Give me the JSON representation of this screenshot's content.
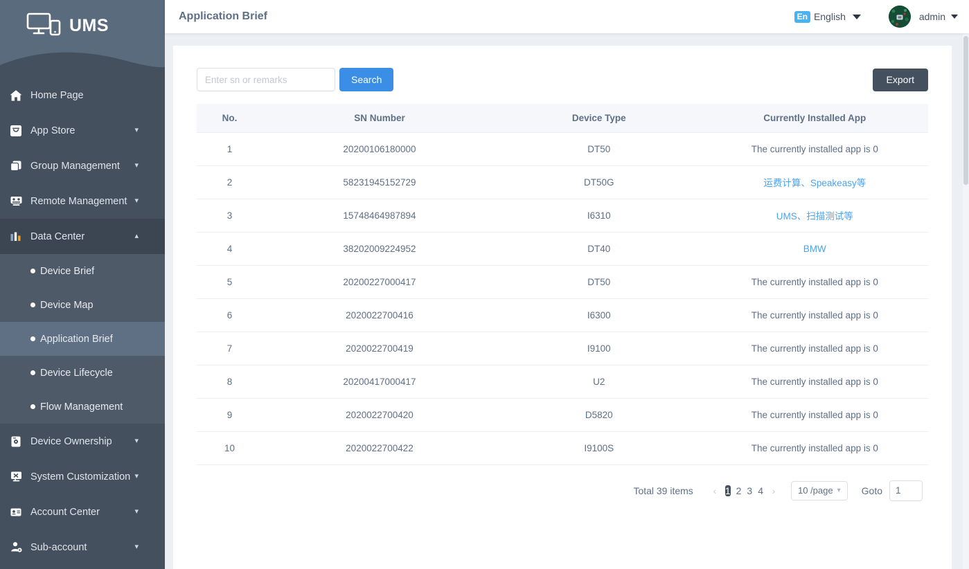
{
  "brand": {
    "logo_text": "UMS",
    "logo_icon": "devices-icon"
  },
  "header": {
    "title": "Application Brief",
    "language": {
      "badge": "En",
      "label": "English",
      "icon": "chevron-down-icon"
    },
    "user": {
      "name": "admin",
      "avatar_icon": "user-avatar"
    }
  },
  "colors": {
    "sidebar_bg": "#44505e",
    "sidebar_logo_bg": "#5a6b7d",
    "sidebar_sub_bg": "#4e5a68",
    "sidebar_active": "#5f7085",
    "primary_blue": "#3a8ee6",
    "link_blue": "#4aa3f0",
    "dark_button": "#44505e",
    "lang_badge": "#4ab3ee",
    "page_bg": "#eceff3"
  },
  "sidebar": {
    "items": [
      {
        "label": "Home Page",
        "icon": "home-icon",
        "caret": "",
        "expandable": false
      },
      {
        "label": "App Store",
        "icon": "appstore-icon",
        "caret": "⌄",
        "expandable": true
      },
      {
        "label": "Group Management",
        "icon": "group-icon",
        "caret": "⌄",
        "expandable": true
      },
      {
        "label": "Remote Management",
        "icon": "remote-icon",
        "caret": "⌄",
        "expandable": true
      },
      {
        "label": "Data Center",
        "icon": "chart-icon",
        "caret": "⌃",
        "expandable": true,
        "open": true
      },
      {
        "label": "Device Ownership",
        "icon": "ownership-icon",
        "caret": "⌄",
        "expandable": true
      },
      {
        "label": "System Customization",
        "icon": "system-icon",
        "caret": "⌄",
        "expandable": true
      },
      {
        "label": "Account Center",
        "icon": "account-icon",
        "caret": "⌄",
        "expandable": true
      },
      {
        "label": "Sub-account",
        "icon": "subaccount-icon",
        "caret": "⌄",
        "expandable": true
      }
    ],
    "data_center_subitems": [
      {
        "label": "Device Brief",
        "active": false
      },
      {
        "label": "Device Map",
        "active": false
      },
      {
        "label": "Application Brief",
        "active": true
      },
      {
        "label": "Device Lifecycle",
        "active": false
      },
      {
        "label": "Flow Management",
        "active": false
      }
    ]
  },
  "toolbar": {
    "search_placeholder": "Enter sn or remarks",
    "search_value": "",
    "search_label": "Search",
    "export_label": "Export"
  },
  "table": {
    "columns": [
      "No.",
      "SN Number",
      "Device Type",
      "Currently Installed App"
    ],
    "rows": [
      {
        "no": "1",
        "sn": "20200106180000",
        "device_type": "DT50",
        "app": "The currently installed app is 0",
        "app_is_link": false
      },
      {
        "no": "2",
        "sn": "58231945152729",
        "device_type": "DT50G",
        "app": "运费计算、Speakeasy等",
        "app_is_link": true
      },
      {
        "no": "3",
        "sn": "15748464987894",
        "device_type": "I6310",
        "app": "UMS、扫描测试等",
        "app_is_link": true
      },
      {
        "no": "4",
        "sn": "38202009224952",
        "device_type": "DT40",
        "app": "BMW",
        "app_is_link": true
      },
      {
        "no": "5",
        "sn": "20200227000417",
        "device_type": "DT50",
        "app": "The currently installed app is 0",
        "app_is_link": false
      },
      {
        "no": "6",
        "sn": "2020022700416",
        "device_type": "I6300",
        "app": "The currently installed app is 0",
        "app_is_link": false
      },
      {
        "no": "7",
        "sn": "2020022700419",
        "device_type": "I9100",
        "app": "The currently installed app is 0",
        "app_is_link": false
      },
      {
        "no": "8",
        "sn": "20200417000417",
        "device_type": "U2",
        "app": "The currently installed app is 0",
        "app_is_link": false
      },
      {
        "no": "9",
        "sn": "2020022700420",
        "device_type": "D5820",
        "app": "The currently installed app is 0",
        "app_is_link": false
      },
      {
        "no": "10",
        "sn": "2020022700422",
        "device_type": "I9100S",
        "app": "The currently installed app is 0",
        "app_is_link": false
      }
    ]
  },
  "pagination": {
    "total_label": "Total 39 items",
    "prev_icon": "‹",
    "next_icon": "›",
    "pages": [
      "1",
      "2",
      "3",
      "4"
    ],
    "current_page": "1",
    "page_size_label": "10 /page",
    "goto_label": "Goto",
    "goto_value": "1"
  }
}
